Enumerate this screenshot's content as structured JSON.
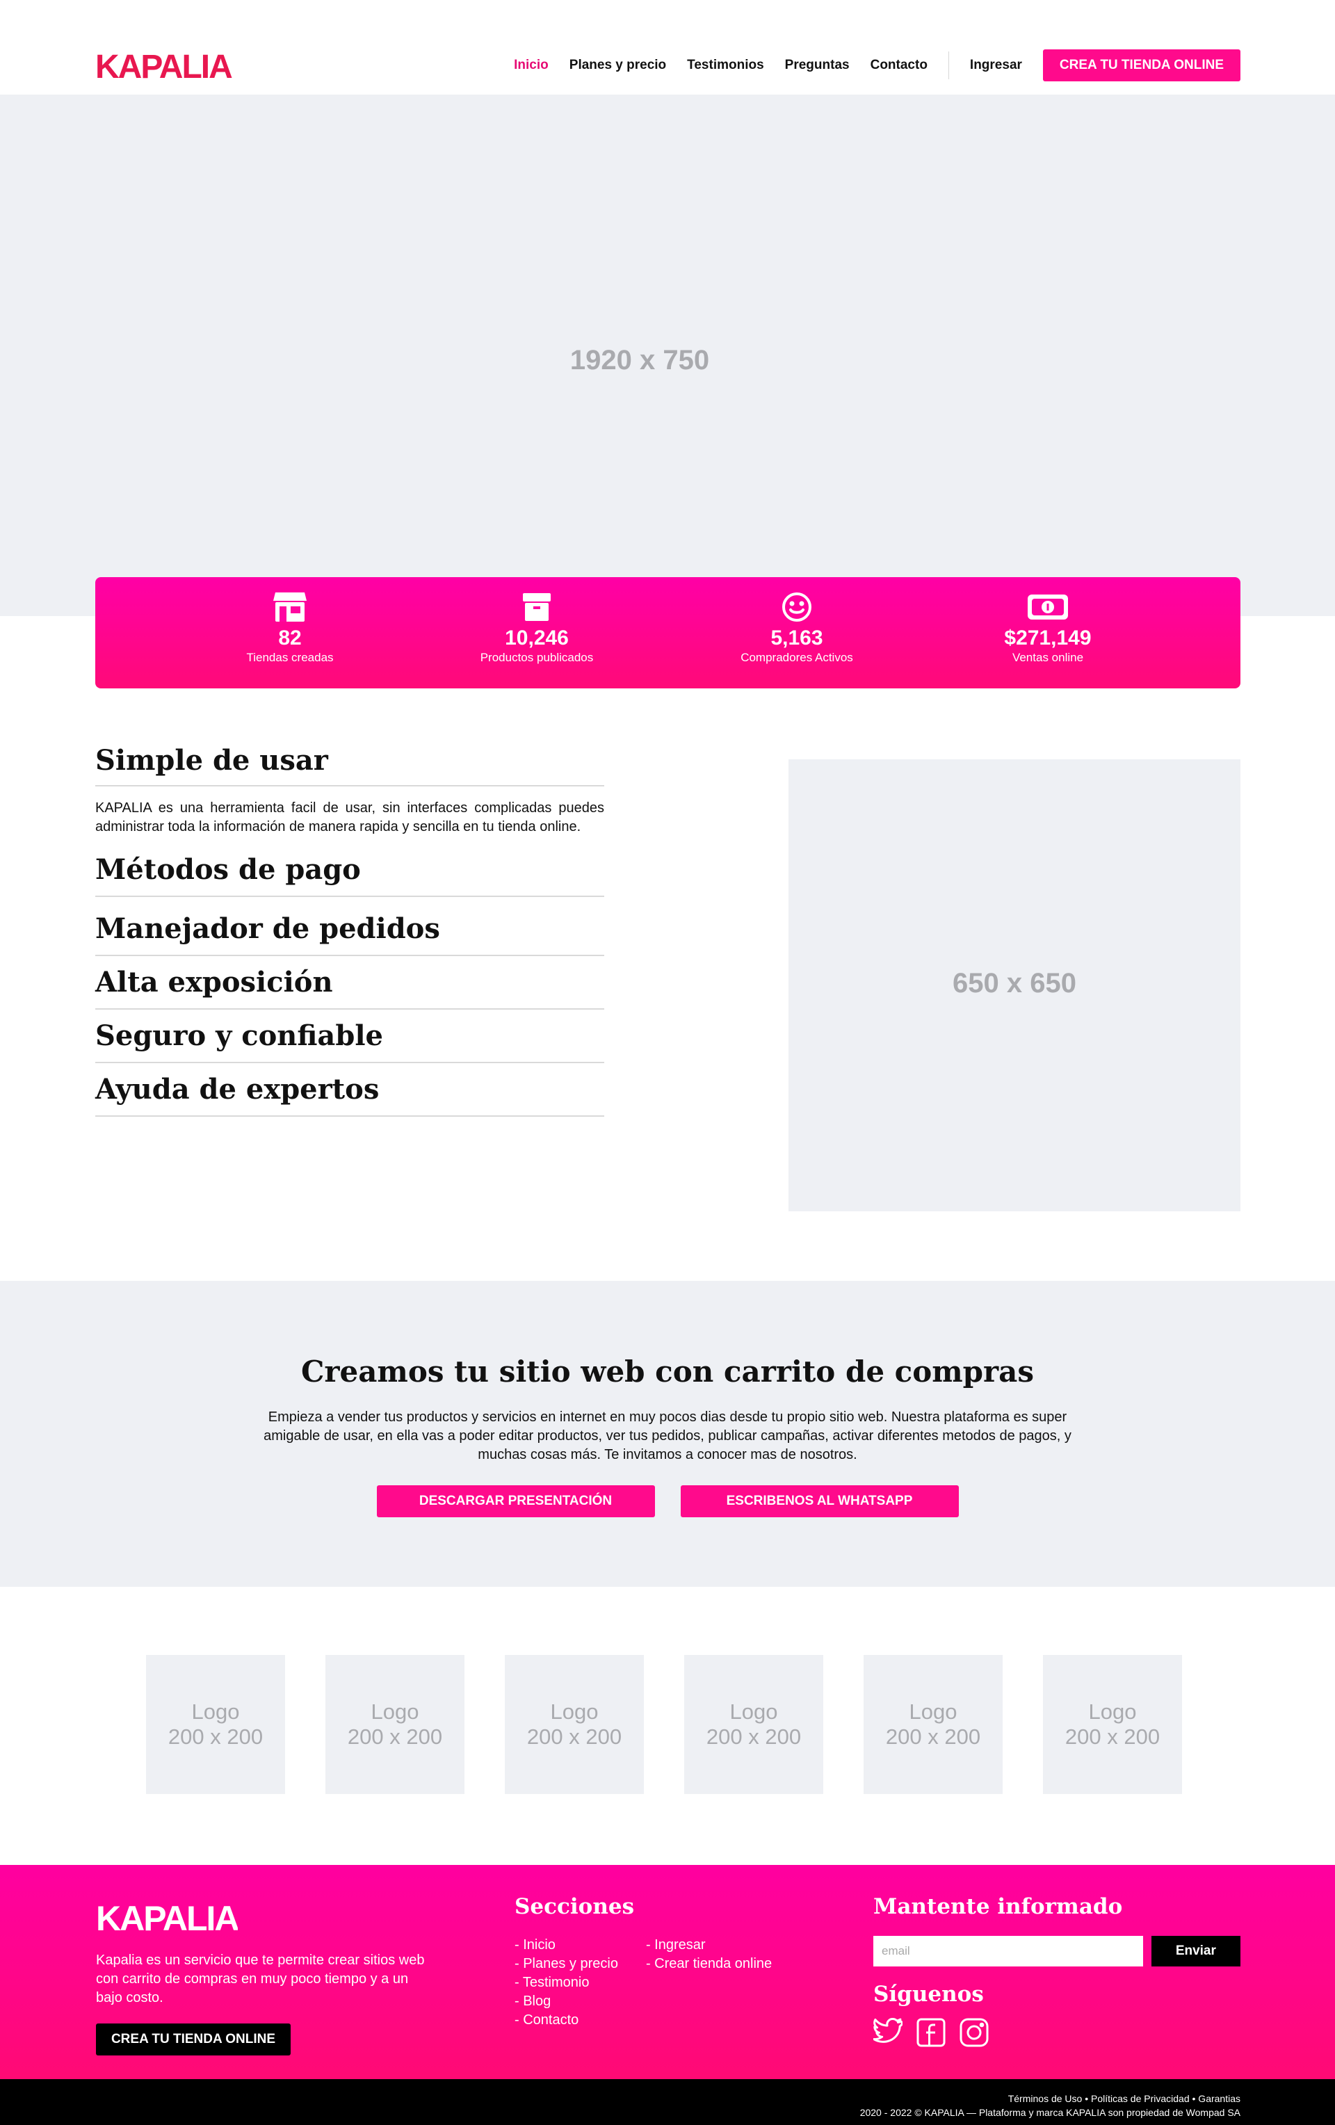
{
  "brand": {
    "name": "KAPALIA",
    "color": "#e8174f",
    "accent": "#ff0a8c"
  },
  "nav": {
    "items": [
      {
        "label": "Inicio",
        "active": true
      },
      {
        "label": "Planes y precio",
        "active": false
      },
      {
        "label": "Testimonios",
        "active": false
      },
      {
        "label": "Preguntas",
        "active": false
      },
      {
        "label": "Contacto",
        "active": false
      }
    ],
    "login": "Ingresar",
    "cta": "CREA TU TIENDA ONLINE"
  },
  "hero": {
    "placeholder": "1920 x 750"
  },
  "stats": [
    {
      "icon": "store-icon",
      "value": "82",
      "label": "Tiendas creadas"
    },
    {
      "icon": "box-icon",
      "value": "10,246",
      "label": "Productos publicados"
    },
    {
      "icon": "smile-icon",
      "value": "5,163",
      "label": "Compradores Activos"
    },
    {
      "icon": "money-icon",
      "value": "$271,149",
      "label": "Ventas online"
    }
  ],
  "features": [
    {
      "title": "Simple de usar",
      "text": "KAPALIA es una herramienta facil de usar, sin interfaces complicadas puedes administrar toda la información de manera rapida y sencilla en tu tienda online."
    },
    {
      "title": "Métodos de pago",
      "text": ""
    },
    {
      "title": "Manejador de pedidos",
      "text": ""
    },
    {
      "title": "Alta exposición",
      "text": ""
    },
    {
      "title": "Seguro y confiable",
      "text": ""
    },
    {
      "title": "Ayuda de expertos",
      "text": ""
    }
  ],
  "feature_image": {
    "placeholder": "650 x 650"
  },
  "band": {
    "title": "Creamos tu sitio web con carrito de compras",
    "text": "Empieza a vender tus productos y servicios en internet en muy pocos dias desde tu propio sitio web.  Nuestra plataforma es super amigable de usar, en ella vas a poder editar productos, ver tus pedidos,  publicar campañas,  activar diferentes metodos de pagos, y muchas cosas más. Te invitamos a conocer mas de nosotros.",
    "button1": "DESCARGAR PRESENTACIÓN",
    "button2": "ESCRIBENOS AL WHATSAPP"
  },
  "logos": [
    {
      "line1": "Logo",
      "line2": "200 x 200"
    },
    {
      "line1": "Logo",
      "line2": "200 x 200"
    },
    {
      "line1": "Logo",
      "line2": "200 x 200"
    },
    {
      "line1": "Logo",
      "line2": "200 x 200"
    },
    {
      "line1": "Logo",
      "line2": "200 x 200"
    },
    {
      "line1": "Logo",
      "line2": "200 x 200"
    }
  ],
  "footer": {
    "description": "Kapalia es un servicio que te permite crear sitios web con carrito de compras en muy poco tiempo y a un bajo costo.",
    "cta": "CREA TU TIENDA ONLINE",
    "sections_title": "Secciones",
    "sections_col1": [
      "- Inicio",
      "- Planes y precio",
      "- Testimonio",
      "- Blog",
      "- Contacto"
    ],
    "sections_col2": [
      "- Ingresar",
      "- Crear tienda online"
    ],
    "newsletter_title": "Mantente informado",
    "email_placeholder": "email",
    "send": "Enviar",
    "follow_title": "Síguenos",
    "social": [
      "twitter-icon",
      "facebook-icon",
      "instagram-icon"
    ]
  },
  "bottom": {
    "links": "Términos de Uso • Políticas de Privacidad • Garantias",
    "copyright": "2020 - 2022 ©  KAPALIA — Plataforma y marca KAPALIA son propiedad de Wompad SA"
  }
}
